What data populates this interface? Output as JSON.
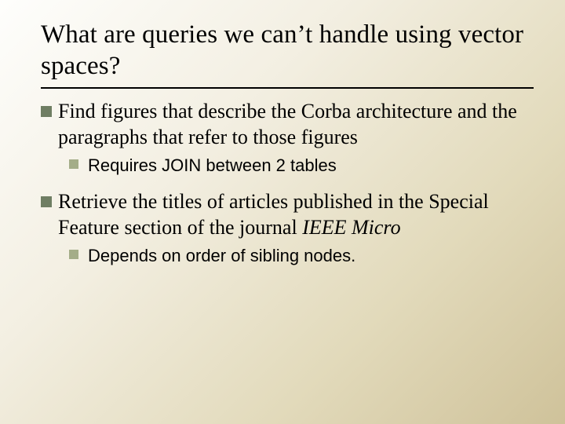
{
  "slide": {
    "title": "What are queries we can’t handle using vector spaces?",
    "items": [
      {
        "text_plain": "Find figures that describe the Corba architecture and the paragraphs that refer to those figures",
        "sub": [
          {
            "text": "Requires JOIN between 2 tables"
          }
        ]
      },
      {
        "text_prefix": "Retrieve the titles of articles published in the Special Feature section of the journal ",
        "text_italic": "IEEE Micro",
        "sub": [
          {
            "text": "Depends on order of sibling nodes."
          }
        ]
      }
    ]
  }
}
